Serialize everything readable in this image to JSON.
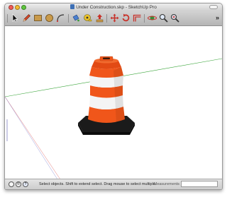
{
  "window": {
    "title": "Under Construction.skp - SketchUp Pro"
  },
  "toolbar": {
    "tools": [
      {
        "name": "select-tool-icon"
      },
      {
        "name": "pencil-line-tool-icon"
      },
      {
        "name": "rectangle-tool-icon"
      },
      {
        "name": "circle-tool-icon"
      },
      {
        "name": "arc-tool-icon"
      },
      {
        "name": "paint-bucket-tool-icon"
      },
      {
        "name": "tape-measure-tool-icon"
      },
      {
        "name": "push-pull-tool-icon"
      },
      {
        "name": "move-tool-icon"
      },
      {
        "name": "rotate-tool-icon"
      },
      {
        "name": "offset-tool-icon"
      },
      {
        "name": "orbit-tool-icon"
      },
      {
        "name": "zoom-tool-icon"
      },
      {
        "name": "zoom-extents-tool-icon"
      }
    ],
    "overflow_label": "»"
  },
  "status": {
    "icons": [
      "geo-location-icon",
      "credits-icon",
      "help-icon"
    ],
    "icon_glyphs": [
      "",
      "©",
      "?"
    ],
    "message": "Select objects. Shift to extend select. Drag mouse to select multiple.",
    "measurements_label": "Measurements",
    "measurements_value": ""
  },
  "colors": {
    "cone_orange": "#f0561a",
    "cone_white": "#f4f4f4",
    "base_black": "#1b1b1b",
    "green_axis": "#3aa53a",
    "red_axis": "#d84040",
    "blue_axis": "#7070c8"
  }
}
